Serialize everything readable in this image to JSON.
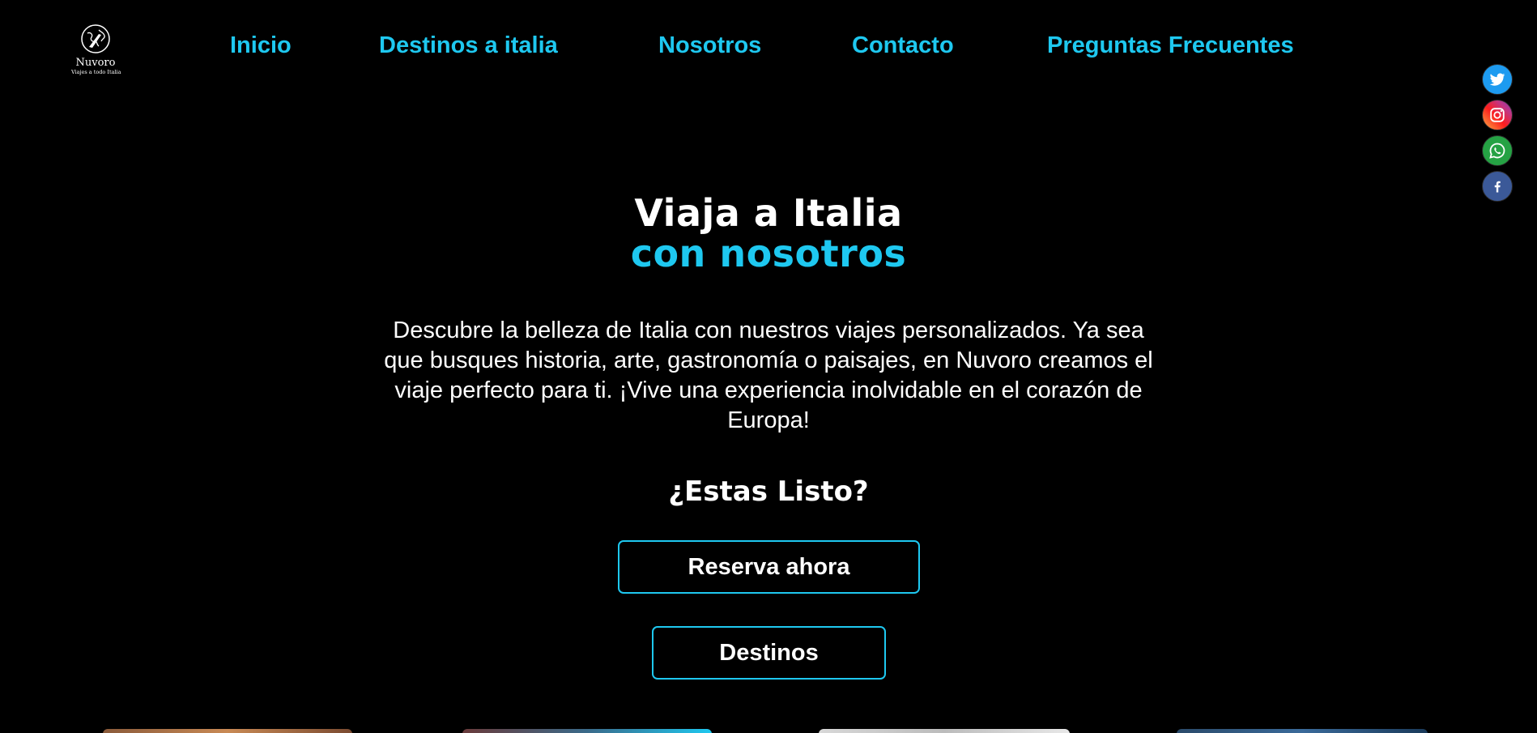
{
  "brand": {
    "name": "Nuvoro",
    "tagline": "Viajes a todo Italia"
  },
  "nav": {
    "items": [
      {
        "label": "Inicio"
      },
      {
        "label": "Destinos a italia"
      },
      {
        "label": "Nosotros"
      },
      {
        "label": "Contacto"
      },
      {
        "label": "Preguntas Frecuentes"
      }
    ]
  },
  "social": [
    {
      "icon": "twitter-icon"
    },
    {
      "icon": "instagram-icon"
    },
    {
      "icon": "whatsapp-icon"
    },
    {
      "icon": "facebook-icon"
    }
  ],
  "hero": {
    "title_line1": "Viaja a Italia",
    "title_line2": "con nosotros",
    "description": "Descubre la belleza de Italia con nuestros viajes personalizados. Ya sea que busques historia, arte, gastronomía o paisajes, en Nuvoro creamos el viaje perfecto para ti. ¡Vive una experiencia inolvidable en el corazón de Europa!",
    "ready": "¿Estas Listo?",
    "reserve_label": "Reserva ahora",
    "destinations_label": "Destinos"
  },
  "colors": {
    "accent": "#1ec8f0",
    "background": "#000000",
    "text": "#ffffff"
  }
}
